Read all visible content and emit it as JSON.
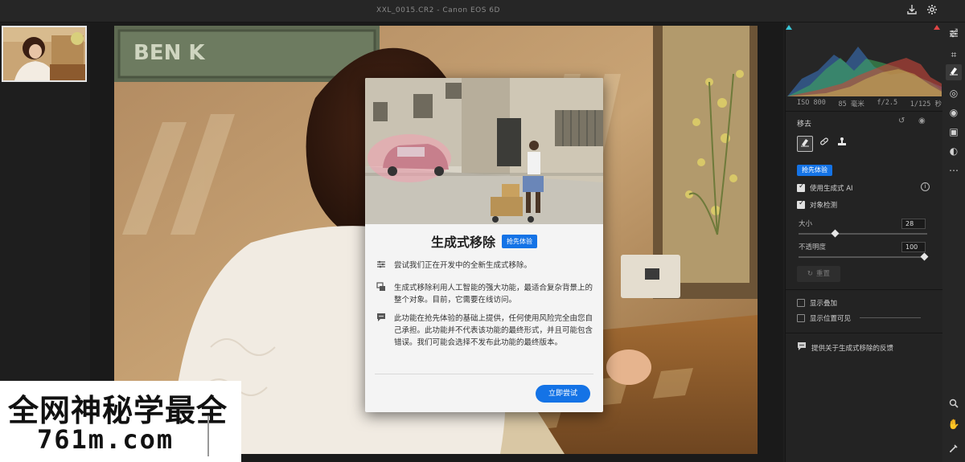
{
  "window": {
    "title": "XXL_0015.CR2  -  Canon EOS 6D"
  },
  "topbar": {
    "export_icon": "export-icon",
    "settings_icon": "gear-icon"
  },
  "photo": {
    "background_sign_text": "BEN K"
  },
  "dialog": {
    "title": "生成式移除",
    "badge": "抢先体验",
    "items": [
      {
        "icon": "sliders-icon",
        "text": "尝试我们正在开发中的全新生成式移除。"
      },
      {
        "icon": "layers-icon",
        "text": "生成式移除利用人工智能的强大功能，最适合复杂背景上的整个对象。目前，它需要在线访问。"
      },
      {
        "icon": "comment-icon",
        "text": "此功能在抢先体验的基础上提供，任何使用风险完全由您自己承担。此功能并不代表该功能的最终形式，并且可能包含错误。我们可能会选择不发布此功能的最终版本。"
      }
    ],
    "button": "立即尝试"
  },
  "watermark": {
    "line1": "全网神秘学最全",
    "line2": "761m.com"
  },
  "panel": {
    "exif": [
      "ISO 800",
      "85 毫米",
      "f/2.5",
      "1/125 秒"
    ],
    "section_title": "移去",
    "pill": "抢先体验",
    "options": [
      {
        "label": "使用生成式 AI",
        "checked": true
      },
      {
        "label": "对象检测",
        "checked": true
      }
    ],
    "size_label": "大小",
    "size_value": "28",
    "size_level": 0.28,
    "opacity_label": "不透明度",
    "opacity_value": "100",
    "opacity_level": 1.0,
    "reset": "重置",
    "show_overlay": "显示叠加",
    "show_position": "显示位置可见",
    "feedback": "提供关于生成式移除的反馈"
  },
  "colors": {
    "accent": "#1473e6",
    "panel_bg": "#232323",
    "dialog_bg": "#f4f4f4"
  }
}
